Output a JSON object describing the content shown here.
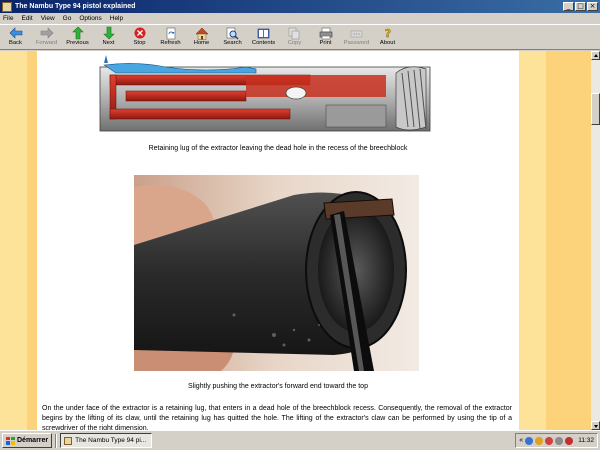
{
  "window": {
    "title": "The Nambu Type 94 pistol explained",
    "controls": [
      "_",
      "□",
      "×"
    ]
  },
  "menu": [
    "File",
    "Edit",
    "View",
    "Go",
    "Options",
    "Help"
  ],
  "toolbar": [
    {
      "label": "Back",
      "icon": "back-arrow-icon",
      "enabled": true
    },
    {
      "label": "Forward",
      "icon": "forward-arrow-icon",
      "enabled": false
    },
    {
      "label": "Previous",
      "icon": "previous-up-arrow-icon",
      "enabled": true
    },
    {
      "label": "Next",
      "icon": "next-down-arrow-icon",
      "enabled": true
    },
    {
      "label": "Stop",
      "icon": "stop-icon",
      "enabled": true
    },
    {
      "label": "Refresh",
      "icon": "refresh-icon",
      "enabled": true
    },
    {
      "label": "Home",
      "icon": "home-icon",
      "enabled": true
    },
    {
      "label": "Search",
      "icon": "search-icon",
      "enabled": true
    },
    {
      "label": "Contents",
      "icon": "contents-icon",
      "enabled": true
    },
    {
      "label": "Copy",
      "icon": "copy-icon",
      "enabled": false
    },
    {
      "label": "Print",
      "icon": "print-icon",
      "enabled": true
    },
    {
      "label": "Password",
      "icon": "password-icon",
      "enabled": false
    },
    {
      "label": "About",
      "icon": "about-icon",
      "enabled": true
    }
  ],
  "content": {
    "caption1": "Retaining lug of the extractor leaving the dead hole in the recess of  the breechblock",
    "caption2": "Slightly pushing the extractor's forward end toward the top",
    "paragraph": "On the under face of the extractor is a retaining lug, that enters in a dead hole of the breechblock recess. Consequently, the removal of the extractor begins by the lifting of its claw, until the retaining lug has quitted the hole. The lifting of the extractor's claw can be performed by using the tip of a screwdriver of the right dimension."
  },
  "colors": {
    "band_light": "#fde39a",
    "band_dark": "#fcd37a",
    "titlebar": "#0a246a"
  },
  "taskbar": {
    "start_label": "Démarrer",
    "task_label": "The Nambu Type 94 pi...",
    "clock": "11:32"
  }
}
